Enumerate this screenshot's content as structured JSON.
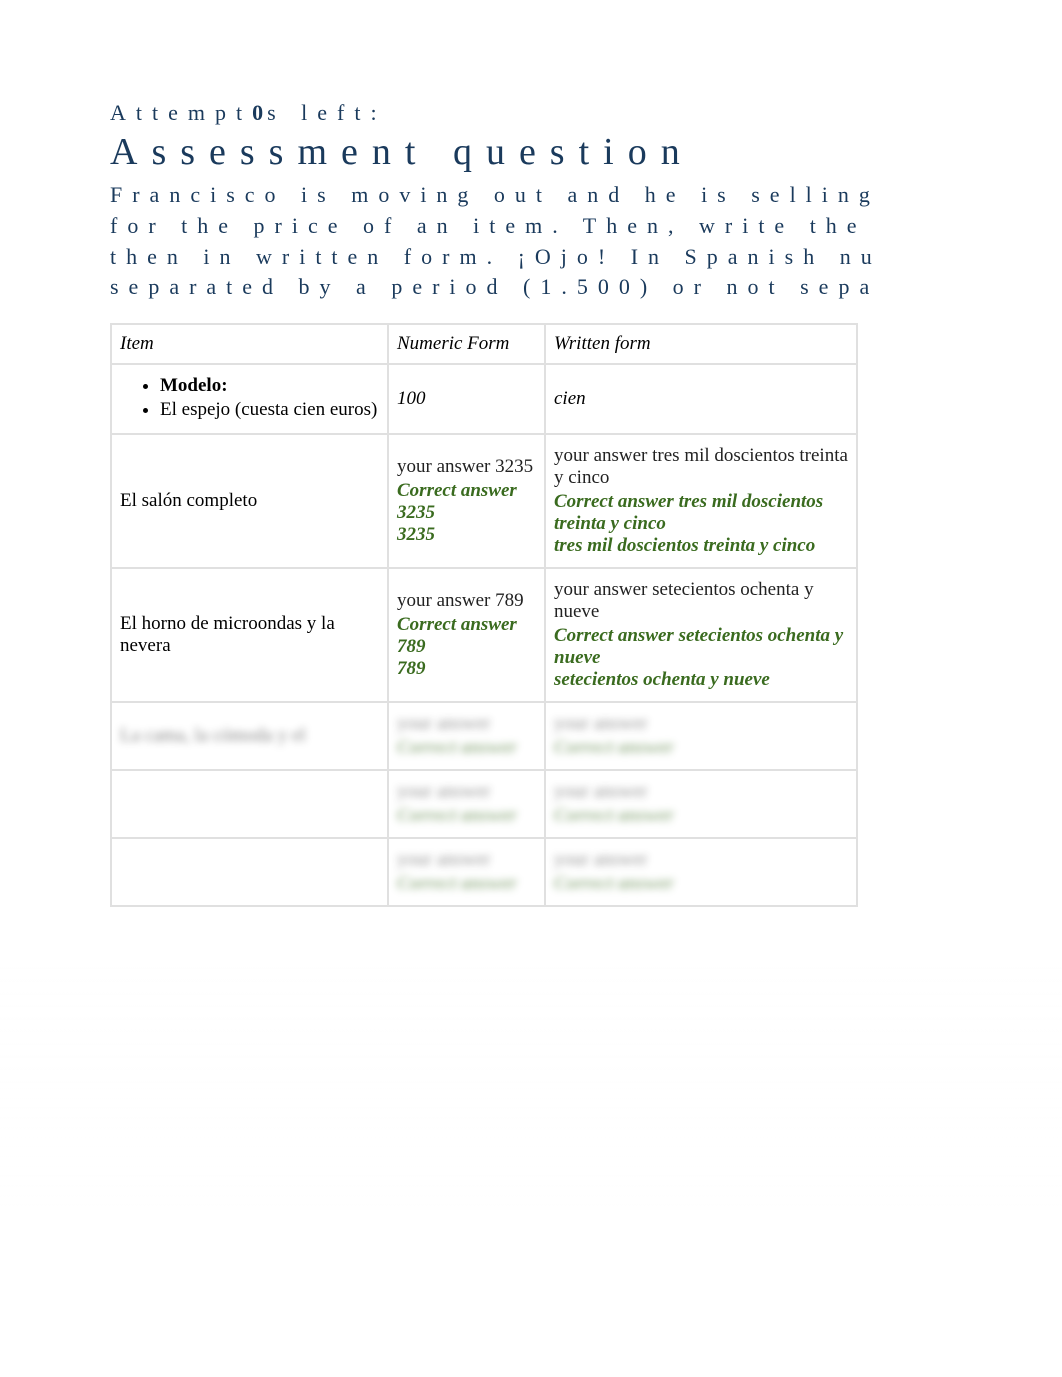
{
  "attempts": {
    "label_prefix": "Attempt",
    "count": "0",
    "label_suffix": "s left:"
  },
  "title": "Assessment question",
  "instructions": {
    "line1": "Francisco is moving out and he is selling",
    "line2": "for the price of an item. Then, write the",
    "line3": "then in written form. ¡Ojo! In Spanish nu",
    "line4": "separated by a period (1.500) or not sepa"
  },
  "headers": {
    "item": "Item",
    "numeric": "Numeric Form",
    "written": "Written form"
  },
  "model": {
    "label": "Modelo:",
    "example_text": "El espejo (cuesta cien euros)",
    "numeric": "100",
    "written": "cien"
  },
  "rows": [
    {
      "item": "El salón completo",
      "your_num_label": "your answer",
      "your_num": "3235",
      "correct_num_label": "Correct answer 3235",
      "correct_num": "3235",
      "your_written_label": "your answer",
      "your_written": "tres mil doscientos treinta y cinco",
      "correct_written_label": "Correct answer tres mil doscientos treinta y cinco",
      "correct_written": "tres mil doscientos treinta y cinco"
    },
    {
      "item": "El horno de microondas y la nevera",
      "your_num_label": "your answer",
      "your_num": "789",
      "correct_num_label": "Correct answer 789",
      "correct_num": "789",
      "your_written_label": "your answer",
      "your_written": "setecientos ochenta y nueve",
      "correct_written_label": "Correct answer setecientos ochenta y nueve",
      "correct_written": "setecientos ochenta y nueve"
    },
    {
      "item": "La cama, la cómoda y el",
      "your_num_label": "your answer",
      "your_num": "",
      "correct_num_label": "Correct answer",
      "correct_num": "",
      "your_written_label": "your answer",
      "your_written": "",
      "correct_written_label": "Correct answer",
      "correct_written": ""
    },
    {
      "item": "",
      "your_num_label": "your answer",
      "your_num": "",
      "correct_num_label": "Correct answer",
      "correct_num": "",
      "your_written_label": "your answer",
      "your_written": "",
      "correct_written_label": "Correct answer",
      "correct_written": ""
    },
    {
      "item": "",
      "your_num_label": "your answer",
      "your_num": "",
      "correct_num_label": "Correct answer",
      "correct_num": "",
      "your_written_label": "your answer",
      "your_written": "",
      "correct_written_label": "Correct answer",
      "correct_written": ""
    }
  ]
}
